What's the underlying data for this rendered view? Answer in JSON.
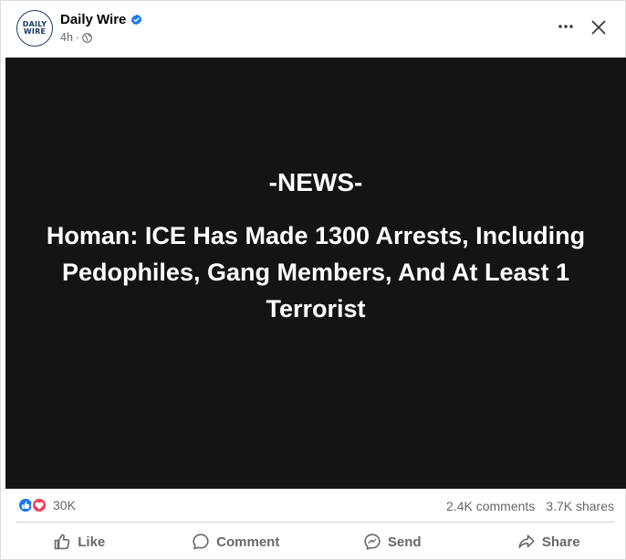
{
  "post": {
    "author": "Daily Wire",
    "avatar_text_line1": "DAILY",
    "avatar_text_line2": "WIRE",
    "time": "4h",
    "separator": "·",
    "verified_icon": "verified-badge-icon",
    "privacy_icon": "globe-icon"
  },
  "media": {
    "kicker": "-NEWS-",
    "headline": "Homan: ICE Has Made 1300 Arrests, Including Pedophiles, Gang Members, And At Least 1 Terrorist"
  },
  "stats": {
    "reaction_count": "30K",
    "comments": "2.4K comments",
    "shares": "3.7K shares",
    "reaction_icons": [
      "like-reaction-icon",
      "love-reaction-icon"
    ]
  },
  "actions": {
    "like": "Like",
    "comment": "Comment",
    "send": "Send",
    "share": "Share"
  },
  "colors": {
    "brand_blue": "#1877f2",
    "love_red": "#f33e58",
    "muted_text": "#65676b",
    "media_background": "#141414",
    "avatar_navy": "#1b3b66"
  }
}
